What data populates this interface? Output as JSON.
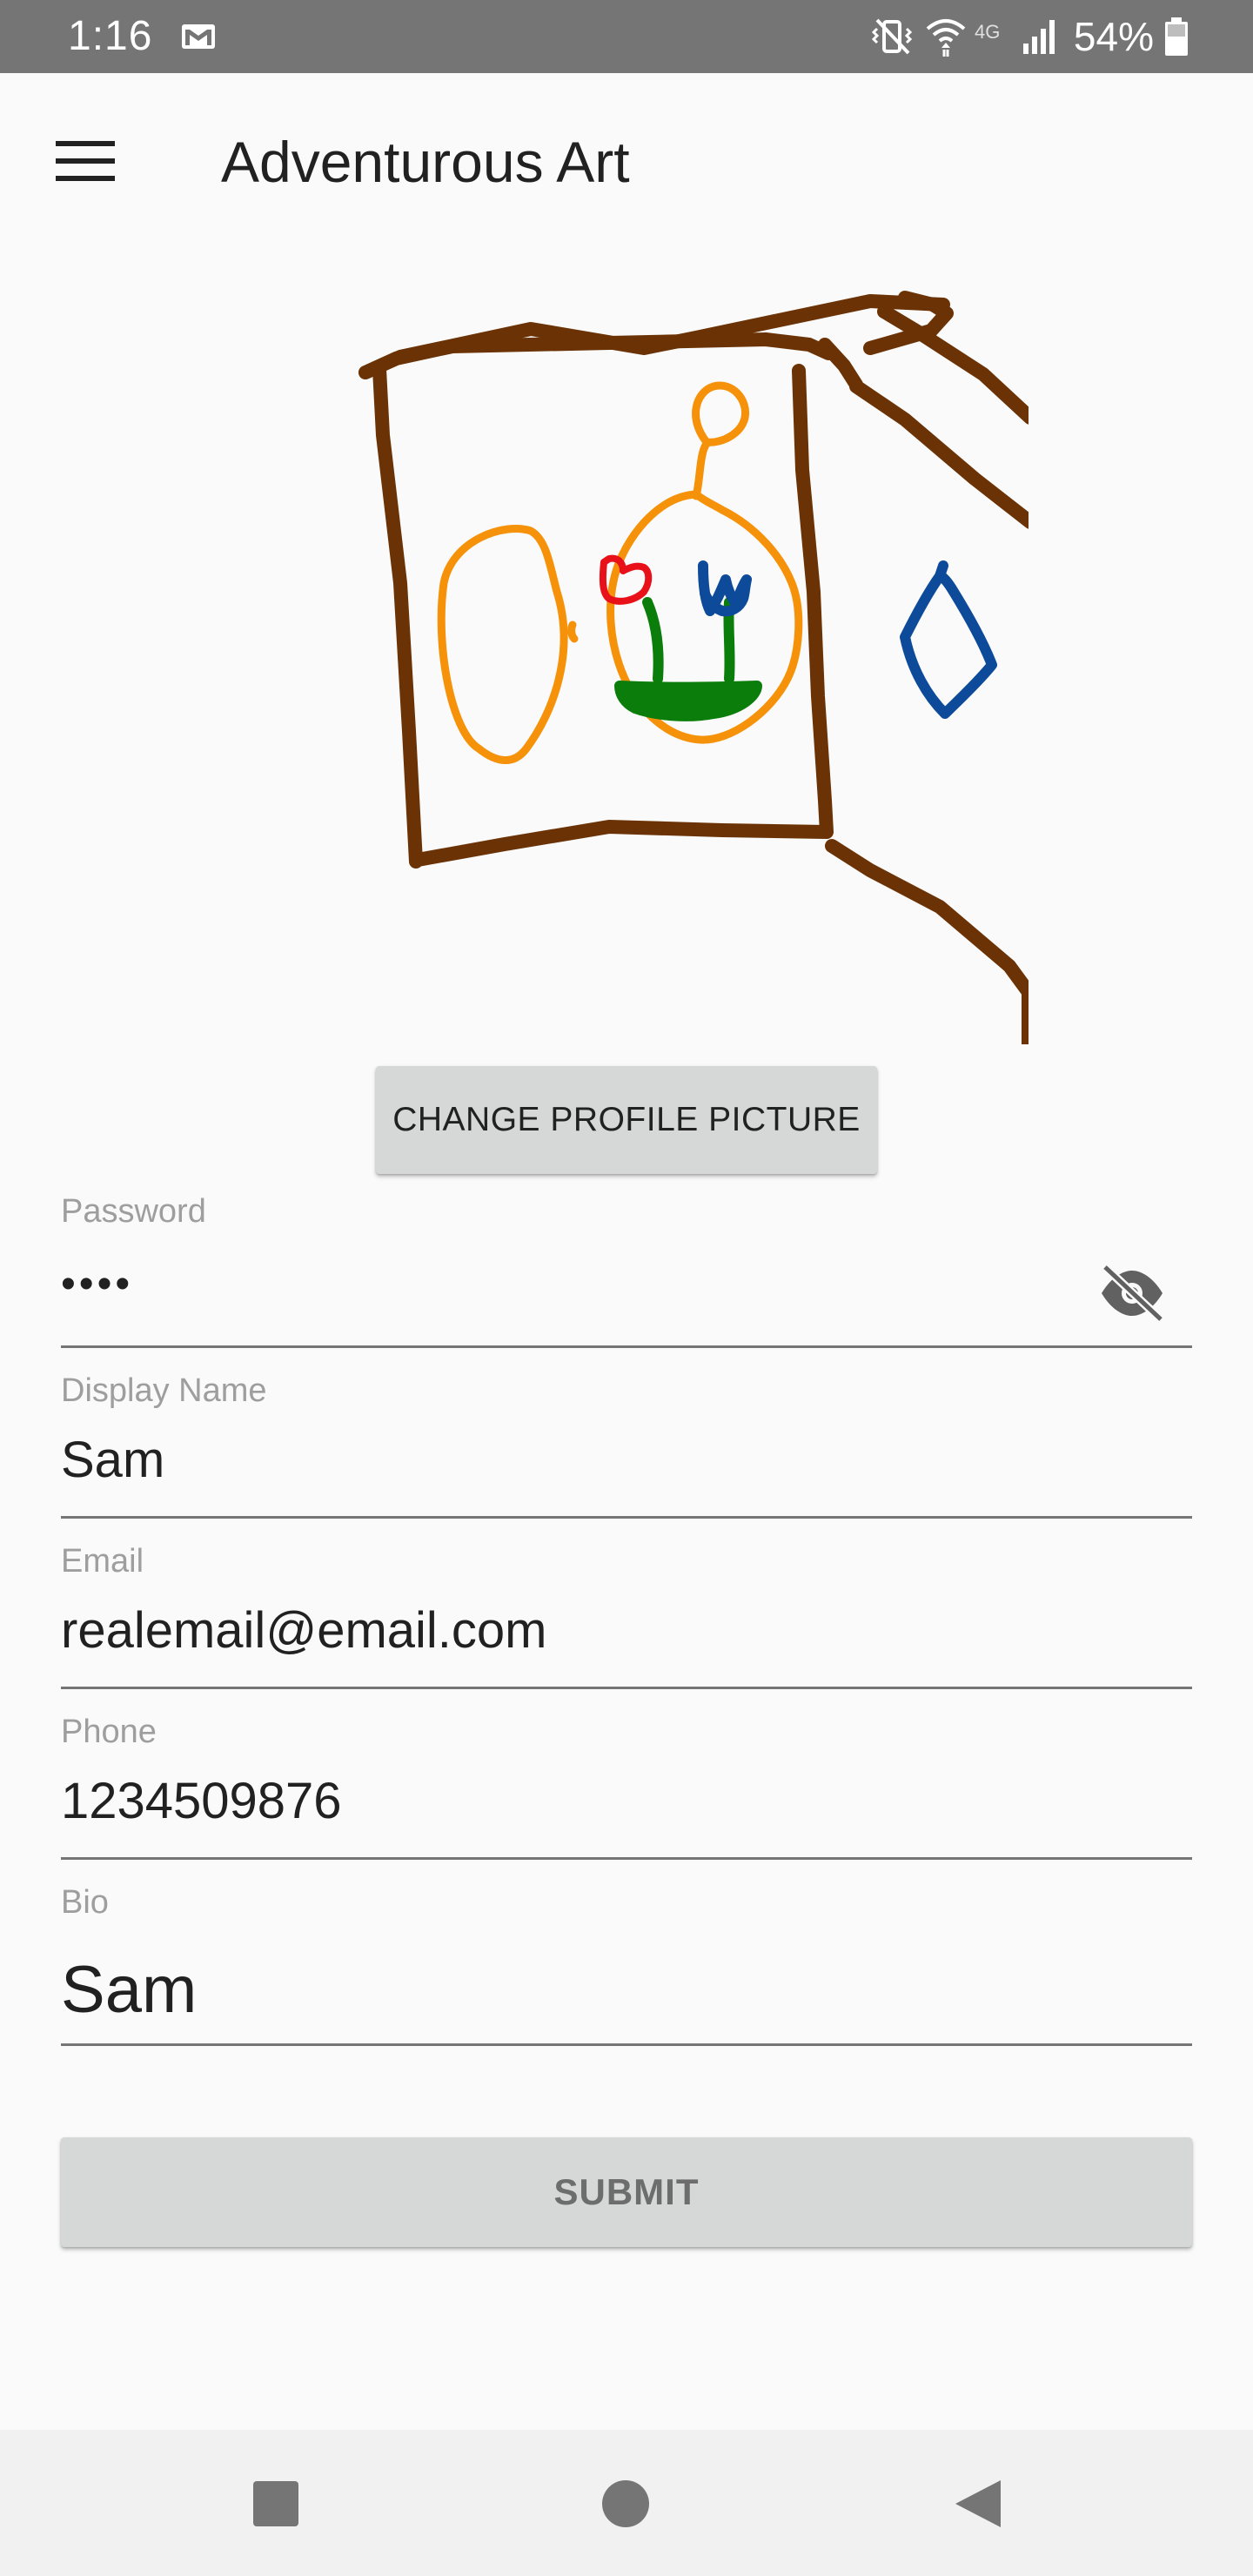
{
  "status_bar": {
    "time": "1:16",
    "battery_percent": "54%",
    "network": "4G",
    "icons": [
      "mail-icon",
      "vibrate-icon",
      "wifi-icon",
      "signal-icon",
      "battery-icon"
    ]
  },
  "app_bar": {
    "title": "Adventurous Art",
    "menu_icon": "menu-icon"
  },
  "profile": {
    "change_picture_label": "CHANGE PROFILE PICTURE"
  },
  "form": {
    "password": {
      "label": "Password",
      "value": "••••",
      "toggle_icon": "visibility-off-icon"
    },
    "display_name": {
      "label": "Display Name",
      "value": "Sam"
    },
    "email": {
      "label": "Email",
      "value": "realemail@email.com"
    },
    "phone": {
      "label": "Phone",
      "value": "1234509876"
    },
    "bio": {
      "label": "Bio",
      "value": "Sam"
    },
    "submit_label": "SUBMIT"
  },
  "nav_bar": {
    "icons": [
      "recents-icon",
      "home-icon",
      "back-icon"
    ]
  },
  "colors": {
    "status_bar": "#757575",
    "background": "#fafafa",
    "button": "#d6d7d7",
    "drawing_brown": "#6b3305",
    "drawing_orange": "#f5920a",
    "drawing_red": "#e8111a",
    "drawing_green": "#0a7d0a",
    "drawing_blue": "#0d4a9a"
  }
}
